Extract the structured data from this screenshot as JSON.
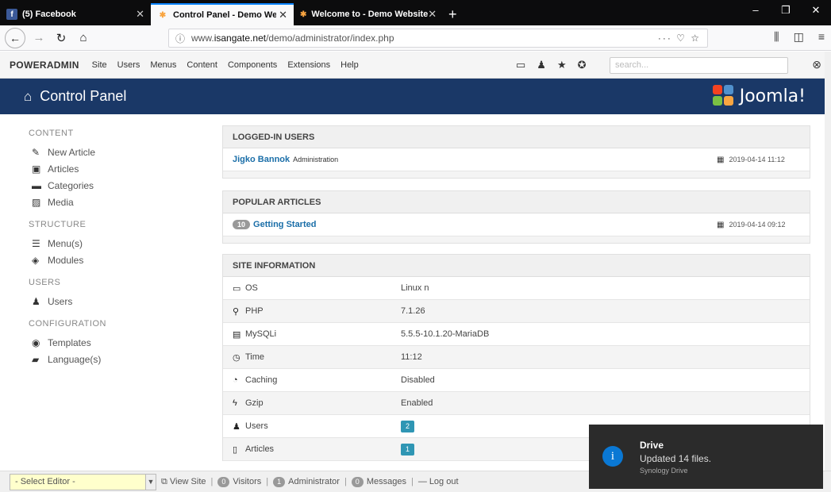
{
  "browser": {
    "tabs": [
      {
        "label": "(5) Facebook",
        "icon": "facebook-icon"
      },
      {
        "label": "Control Panel - Demo Website",
        "icon": "joomla-icon"
      },
      {
        "label": "Welcome to - Demo Website",
        "icon": "joomla-icon"
      }
    ],
    "url_prefix": "www.",
    "url_host": "isangate.net",
    "url_path": "/demo/administrator/index.php",
    "url_tail": "··· ♡ ☆"
  },
  "admin_menu": {
    "brand": "POWERADMIN",
    "items": [
      "Site",
      "Users",
      "Menus",
      "Content",
      "Components",
      "Extensions",
      "Help"
    ],
    "search_placeholder": "search..."
  },
  "header": {
    "title": "Control Panel",
    "logo_text": "Joomla!"
  },
  "sidebar": {
    "sections": [
      {
        "title": "CONTENT",
        "items": [
          {
            "label": "New Article",
            "icon": "pencil-icon"
          },
          {
            "label": "Articles",
            "icon": "articles-icon"
          },
          {
            "label": "Categories",
            "icon": "folder-icon"
          },
          {
            "label": "Media",
            "icon": "image-icon"
          }
        ]
      },
      {
        "title": "STRUCTURE",
        "items": [
          {
            "label": "Menu(s)",
            "icon": "menu-icon"
          },
          {
            "label": "Modules",
            "icon": "cube-icon"
          }
        ]
      },
      {
        "title": "USERS",
        "items": [
          {
            "label": "Users",
            "icon": "users-icon"
          }
        ]
      },
      {
        "title": "CONFIGURATION",
        "items": [
          {
            "label": "Templates",
            "icon": "eye-icon"
          },
          {
            "label": "Language(s)",
            "icon": "comments-icon"
          }
        ]
      }
    ]
  },
  "logged_in": {
    "title": "LOGGED-IN USERS",
    "user": "Jigko Bannok",
    "role": "Administration",
    "date": "2019-04-14 11:12"
  },
  "popular": {
    "title": "POPULAR ARTICLES",
    "hits": "10",
    "article": "Getting Started",
    "date": "2019-04-14 09:12"
  },
  "site_info": {
    "title": "SITE INFORMATION",
    "rows": [
      {
        "key": "OS",
        "value": "Linux n",
        "icon": "monitor-icon"
      },
      {
        "key": "PHP",
        "value": "7.1.26",
        "icon": "wrench-icon"
      },
      {
        "key": "MySQLi",
        "value": "5.5.5-10.1.20-MariaDB",
        "icon": "database-icon"
      },
      {
        "key": "Time",
        "value": "11:12",
        "icon": "clock-icon"
      },
      {
        "key": "Caching",
        "value": "Disabled",
        "icon": "dashboard-icon"
      },
      {
        "key": "Gzip",
        "value": "Enabled",
        "icon": "lightning-icon"
      },
      {
        "key": "Users",
        "value": "2",
        "icon": "users-icon"
      },
      {
        "key": "Articles",
        "value": "1",
        "icon": "file-icon"
      }
    ]
  },
  "statusbar": {
    "editor": "- Select Editor -",
    "view_site": "View Site",
    "visitors_count": "0",
    "visitors": "Visitors",
    "admin_count": "1",
    "admin": "Administrator",
    "messages_count": "0",
    "messages": "Messages",
    "logout": "Log out"
  },
  "toast": {
    "title": "Drive",
    "body": "Updated 14 files.",
    "source": "Synology Drive"
  },
  "colors": {
    "header_bg": "#1a3867",
    "link": "#1a6ea8",
    "badge": "#2384d3"
  }
}
